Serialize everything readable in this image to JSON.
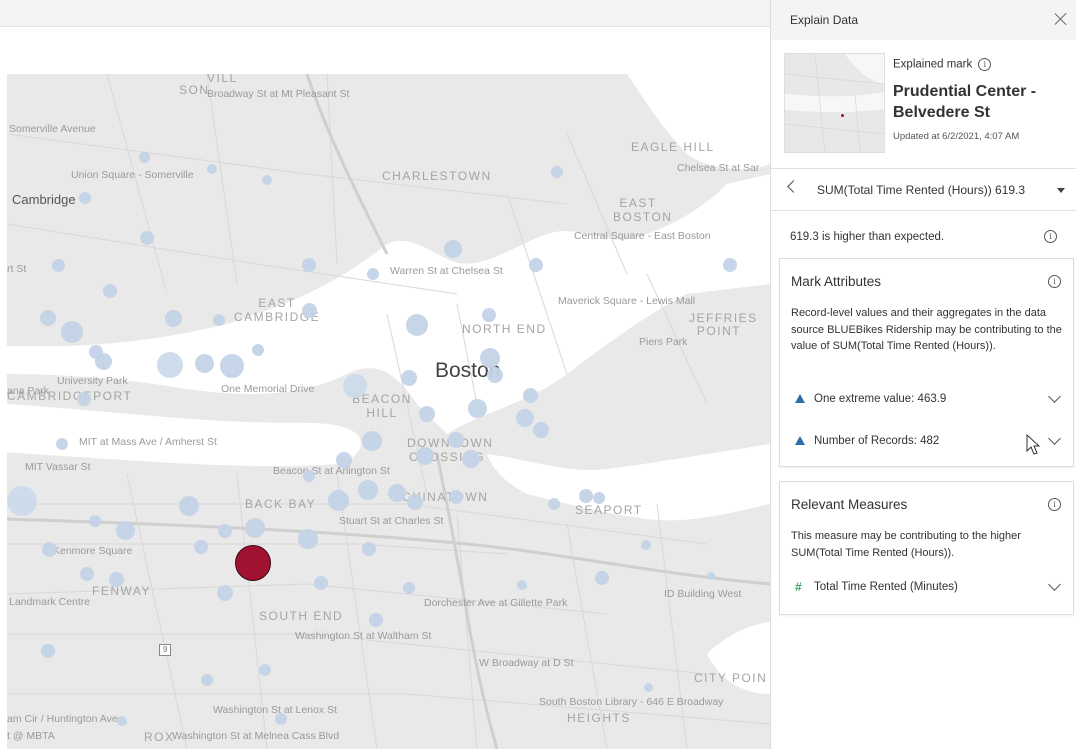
{
  "panel": {
    "title": "Explain Data",
    "explained_label": "Explained mark",
    "mark_name": "Prudential Center - Belvedere St",
    "updated": "Updated at 6/2/2021, 4:07 AM",
    "measure_selector": "SUM(Total Time Rented (Hours))  619.3",
    "expectation_text": "619.3 is higher than expected."
  },
  "mark_attributes": {
    "title": "Mark Attributes",
    "description": "Record-level values and their aggregates in the data source BLUEBikes Ridership may be contributing to the value of SUM(Total Time Rented (Hours)).",
    "items": [
      {
        "label": "One extreme value: 463.9"
      },
      {
        "label": "Number of Records: 482"
      }
    ]
  },
  "relevant_measures": {
    "title": "Relevant Measures",
    "description": "This measure may be contributing to the higher SUM(Total Time Rented (Hours)).",
    "items": [
      {
        "label": "Total Time Rented (Minutes)"
      }
    ]
  },
  "map": {
    "selected_mark_color": "#a01230",
    "dot_color": "#c3d3e6",
    "labels": {
      "cambridge": "Cambridge",
      "boston": "Boston",
      "charlestown": "CHARLESTOWN",
      "eagle_hill": "EAGLE HILL",
      "east_boston": "EAST BOSTON",
      "east_cambridge": "EAST CAMBRIDGE",
      "north_end": "NORTH END",
      "jeffries_point": "JEFFRIES POINT",
      "beacon_hill": "BEACON HILL",
      "downtown": "DOWNTOWN CROSSING",
      "back_bay": "BACK BAY",
      "chinatown": "CHINATOWN",
      "seaport": "SEAPORT",
      "fenway": "FENWAY",
      "south_end": "SOUTH END",
      "city_point": "CITY POIN",
      "heights": "HEIGHTS",
      "cambridgeport": "CAMBRIDGEPORT",
      "broadway_mt_pleasant": "Broadway St at Mt Pleasant St",
      "somerville_ave": "Somerville Avenue",
      "union_square": "Union Square - Somerville",
      "chelsea_st": "Chelsea St at Sar",
      "central_square": "Central Square - East Boston",
      "warren_st": "Warren St at Chelsea St",
      "maverick": "Maverick Square - Lewis Mall",
      "piers_park": "Piers Park",
      "university_park": "University Park",
      "one_memorial": "One Memorial Drive",
      "ana_park": "ana Park",
      "mit_mass": "MIT at Mass Ave / Amherst St",
      "mit_vassar": "MIT Vassar St",
      "beacon_arlington": "Beacon St at Arlington St",
      "stuart_charles": "Stuart St at Charles St",
      "kenmore": "Kenmore Square",
      "landmark": "Landmark Centre",
      "dorchester": "Dorchester Ave at Gillette Park",
      "washington_waltham": "Washington St at Waltham St",
      "id_building": "ID Building West",
      "w_broadway": "W Broadway at D St",
      "south_boston_library": "South Boston Library - 646 E Broadway",
      "huntington": "am Cir / Huntington Ave",
      "washington_lenox": "Washington St at Lenox St",
      "washington_melnea": "Washington St at Melnea Cass Blvd",
      "mbta": "t @ MBTA",
      "roxbury": "ROX",
      "son": "SON",
      "st": "rt St",
      "vill": "VILL",
      "shield": "9"
    }
  }
}
